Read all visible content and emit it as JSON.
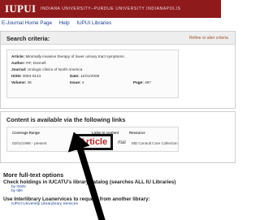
{
  "header": {
    "logo": "IUPUI",
    "university": "INDIANA UNIVERSITY–PURDUE UNIVERSITY INDIANAPOLIS",
    "background_color": "#8f1a1c"
  },
  "nav": {
    "items": [
      "E-Journal Home Page",
      "Help",
      "IUPUI Libraries"
    ]
  },
  "search_criteria": {
    "title": "Search criteria:",
    "refine_link": "Refine or alter criteria",
    "fields": {
      "article_label": "Article:",
      "article": "Minimally invasive therapy of lower urinary tract symptoms.",
      "author_label": "Author:",
      "author": "RF, Donnell",
      "journal_label": "Journal:",
      "journal": "Urologic clinics of North America",
      "issn_label": "ISSN:",
      "issn": "0094-0143",
      "date_label": "Date:",
      "date": "11/01/2009",
      "volume_label": "Volume:",
      "volume": "36",
      "issue_label": "Issue:",
      "issue": "4",
      "page_label": "Page:",
      "page": "497"
    }
  },
  "links": {
    "title": "Content is available via the following links",
    "headers": {
      "coverage": "Coverage Range",
      "links_to_content": "Links to content",
      "resource": "Resource"
    },
    "coverage_value": "02/01/1996 - present",
    "article_button": "Article",
    "fulltext_partial": "rtial",
    "resource_value": "MD Consult Core Collection"
  },
  "more_options": {
    "heading": "More full-text options",
    "check_holdings": "Check holdings in IUCAT",
    "check_holdings_rest": "U's library catalog (searches ALL IU Libraries)",
    "by_issn": "by ISSN",
    "by_title": "by title",
    "ill": "Use Interlibrary Loan",
    "ill_rest": "ervices to request from another library:",
    "ill_link": "IUPUI University Library",
    "ill_link_rest": "brary Services"
  }
}
